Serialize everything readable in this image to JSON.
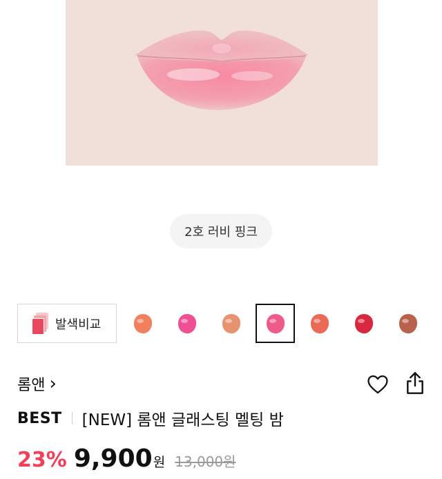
{
  "product_image": {
    "subject": "lip-swatch-photo"
  },
  "shade_chip": {
    "label": "2호 러비 핑크"
  },
  "compare_button": {
    "label": "발색비교",
    "icon": "color-cards-icon"
  },
  "swatches": [
    {
      "color": "#f0805e",
      "selected": false
    },
    {
      "color": "#ef4f93",
      "selected": false
    },
    {
      "color": "#e79271",
      "selected": false
    },
    {
      "color": "#ef5b88",
      "selected": true
    },
    {
      "color": "#ea6a55",
      "selected": false
    },
    {
      "color": "#d8283f",
      "selected": false
    },
    {
      "color": "#b8624d",
      "selected": false
    }
  ],
  "brand": {
    "label": "롬앤",
    "chevron": "›"
  },
  "actions": {
    "heart_icon": "heart-outline-icon",
    "share_icon": "share-icon"
  },
  "title": {
    "badge": "BEST",
    "name": "[NEW] 롬앤 글래스팅 멜팅 밤"
  },
  "price": {
    "discount": "23%",
    "current": "9,900",
    "unit": "원",
    "original": "13,000원"
  },
  "colors": {
    "discount": "#f2405a",
    "selected_border": "#111111"
  }
}
